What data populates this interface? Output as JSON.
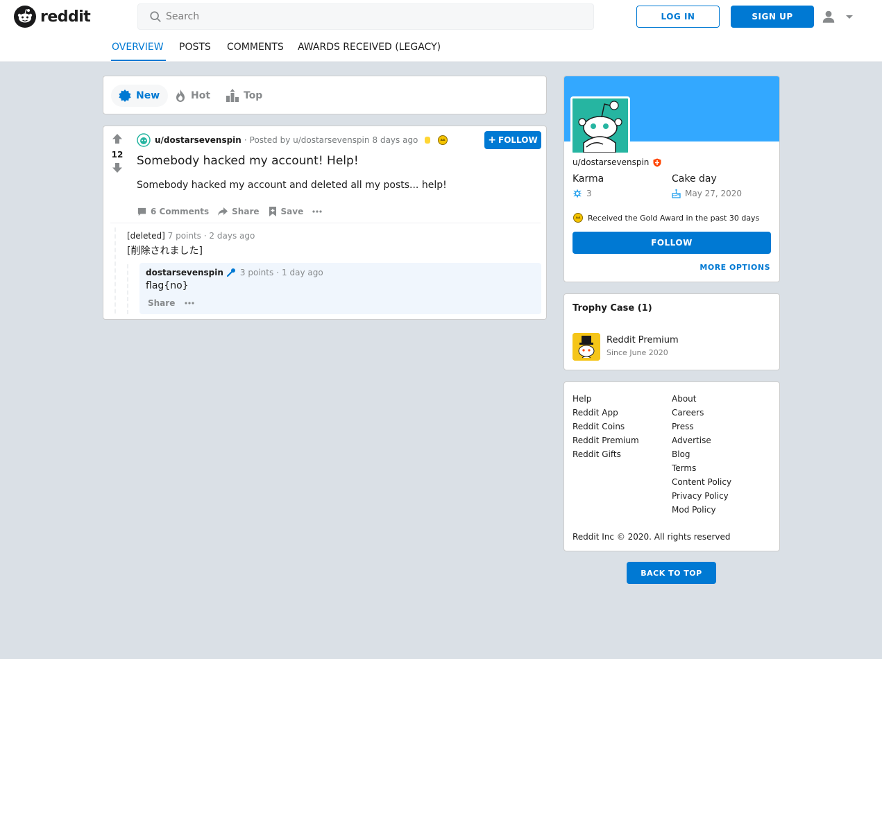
{
  "header": {
    "brand": "reddit",
    "search_placeholder": "Search",
    "login_label": "LOG IN",
    "signup_label": "SIGN UP",
    "icons": [
      "reddit-logo-icon",
      "search-icon",
      "user-icon",
      "caret-down-icon"
    ]
  },
  "tabs": [
    {
      "label": "OVERVIEW",
      "active": true
    },
    {
      "label": "POSTS",
      "active": false
    },
    {
      "label": "COMMENTS",
      "active": false
    },
    {
      "label": "AWARDS RECEIVED (LEGACY)",
      "active": false
    }
  ],
  "sort": {
    "new_label": "New",
    "hot_label": "Hot",
    "top_label": "Top",
    "active": "New"
  },
  "post": {
    "votes": "12",
    "author": "u/dostarsevenspin",
    "posted_by": "Posted by u/dostarsevenspin",
    "time": "8 days ago",
    "follow_label": "FOLLOW",
    "title": "Somebody hacked my account! Help!",
    "body": "Somebody hacked my account and deleted all my posts... help!",
    "comments_label": "6 Comments",
    "share_label": "Share",
    "save_label": "Save"
  },
  "comments": [
    {
      "author": "[deleted]",
      "points": "7 points",
      "time": "2 days ago",
      "body": "[削除されました]"
    },
    {
      "author": "dostarsevenspin",
      "points": "3 points",
      "time": "1 day ago",
      "body": "flag{no}",
      "share_label": "Share"
    }
  ],
  "profile": {
    "username": "u/dostarsevenspin",
    "karma_label": "Karma",
    "karma_value": "3",
    "cakeday_label": "Cake day",
    "cakeday_value": "May 27, 2020",
    "award_text": "Received the Gold Award in the past 30 days",
    "follow_label": "FOLLOW",
    "more_options": "MORE OPTIONS",
    "banner_color": "#33a8ff",
    "avatar_color": "#26b5a1"
  },
  "trophy_case": {
    "title": "Trophy Case (1)",
    "items": [
      {
        "name": "Reddit Premium",
        "since": "Since June 2020"
      }
    ]
  },
  "footer": {
    "col1": [
      "Help",
      "Reddit App",
      "Reddit Coins",
      "Reddit Premium",
      "Reddit Gifts"
    ],
    "col2": [
      "About",
      "Careers",
      "Press",
      "Advertise",
      "Blog",
      "Terms",
      "Content Policy",
      "Privacy Policy",
      "Mod Policy"
    ],
    "copyright": "Reddit Inc © 2020. All rights reserved",
    "back_to_top": "BACK TO TOP"
  },
  "colors": {
    "accent": "#0079d3",
    "page_bg": "#dae0e6",
    "text": "#1c1c1c",
    "muted": "#878a8c"
  }
}
